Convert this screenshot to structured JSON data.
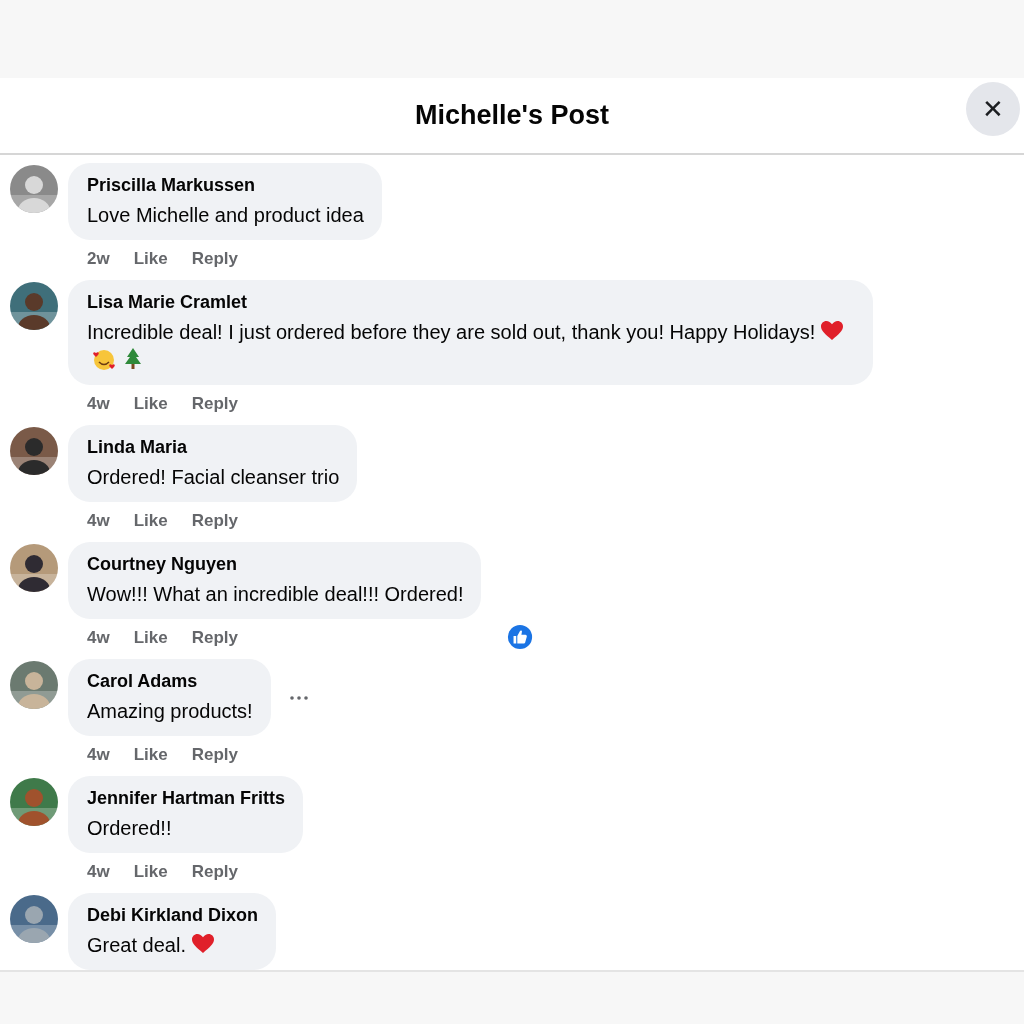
{
  "header": {
    "title": "Michelle's Post",
    "close_label": "✕"
  },
  "comments": [
    {
      "author": "Priscilla Markussen",
      "text": "Love Michelle and product idea",
      "time": "2w",
      "like": "Like",
      "reply": "Reply",
      "liked": false,
      "options_menu": false
    },
    {
      "author": "Lisa Marie Cramlet",
      "text": "Incredible deal! I just ordered before they are sold out, thank you! Happy Holidays!",
      "emojis": [
        {
          "kind": "heart"
        },
        {
          "kind": "smiling-hearts"
        },
        {
          "kind": "tree"
        }
      ],
      "time": "4w",
      "like": "Like",
      "reply": "Reply",
      "liked": false,
      "options_menu": false
    },
    {
      "author": "Linda Maria",
      "text": "Ordered! Facial cleanser trio",
      "time": "4w",
      "like": "Like",
      "reply": "Reply",
      "liked": false,
      "options_menu": false
    },
    {
      "author": "Courtney Nguyen",
      "text": "Wow!!! What an incredible deal!!! Ordered!",
      "time": "4w",
      "like": "Like",
      "reply": "Reply",
      "liked": true,
      "options_menu": false
    },
    {
      "author": "Carol Adams",
      "text": "Amazing products!",
      "time": "4w",
      "like": "Like",
      "reply": "Reply",
      "liked": false,
      "options_menu": true
    },
    {
      "author": "Jennifer Hartman Fritts",
      "text": "Ordered!!",
      "time": "4w",
      "like": "Like",
      "reply": "Reply",
      "liked": false,
      "options_menu": false
    },
    {
      "author": "Debi Kirkland Dixon",
      "text": "Great deal.",
      "emojis": [
        {
          "kind": "heart"
        }
      ],
      "liked": false,
      "options_menu": false
    }
  ]
}
